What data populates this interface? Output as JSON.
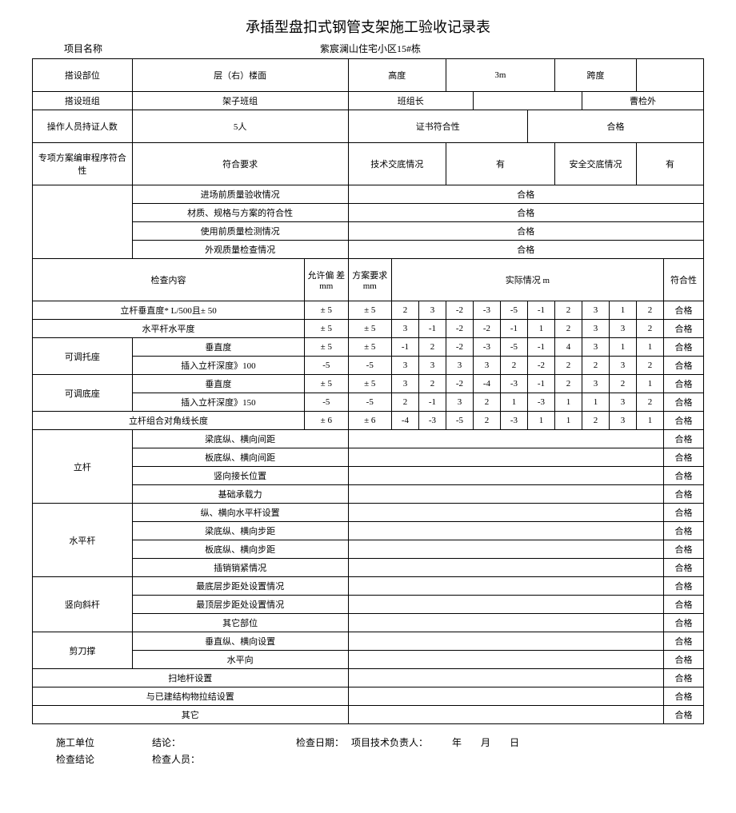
{
  "title": "承插型盘扣式钢管支架施工验收记录表",
  "project_label": "项目名称",
  "project_name": "紫宸澜山住宅小区15#栋",
  "r1": {
    "a": "搭设部位",
    "b": "层（右）楼面",
    "c": "高度",
    "d": "3m",
    "e": "跨度",
    "f": ""
  },
  "r2": {
    "a": "搭设班组",
    "b": "架子班组",
    "c": "班组长",
    "d": "",
    "e": "曹检外"
  },
  "r3": {
    "a": "操作人员持证人数",
    "b": "5人",
    "c": "证书符合性",
    "d": "合格"
  },
  "r4": {
    "a": "专项方案编审程序符合性",
    "b": "符合要求",
    "c": "技术交底情况",
    "d": "有",
    "e": "安全交底情况",
    "f": "有"
  },
  "pre": [
    {
      "label": "进场前质量验收情况",
      "val": "合格"
    },
    {
      "label": "材质、规格与方案的符合性",
      "val": "合格"
    },
    {
      "label": "使用前质量检测情况",
      "val": "合格"
    },
    {
      "label": "外观质量检查情况",
      "val": "合格"
    }
  ],
  "measure_head": {
    "a": "检查内容",
    "b": "允许偏 差 mm",
    "c": "方案要求 mm",
    "d": "实际情况 m",
    "e": "符合性"
  },
  "m": [
    {
      "g": "",
      "label": "立杆垂直度* L/500且± 50",
      "allow": "± 5",
      "plan": "± 5",
      "v": [
        "2",
        "3",
        "-2",
        "-3",
        "-5",
        "-1",
        "2",
        "3",
        "1",
        "2"
      ],
      "ok": "合格"
    },
    {
      "g": "",
      "label": "水平杆水平度",
      "allow": "± 5",
      "plan": "± 5",
      "v": [
        "3",
        "-1",
        "-2",
        "-2",
        "-1",
        "1",
        "2",
        "3",
        "3",
        "2"
      ],
      "ok": "合格"
    },
    {
      "g": "可调托座",
      "label": "垂直度",
      "allow": "± 5",
      "plan": "± 5",
      "v": [
        "-1",
        "2",
        "-2",
        "-3",
        "-5",
        "-1",
        "4",
        "3",
        "1",
        "1"
      ],
      "ok": "合格"
    },
    {
      "g": "",
      "label": "插入立杆深度》100",
      "allow": "-5",
      "plan": "-5",
      "v": [
        "3",
        "3",
        "3",
        "3",
        "2",
        "-2",
        "2",
        "2",
        "3",
        "2"
      ],
      "ok": "合格"
    },
    {
      "g": "可调底座",
      "label": "垂直度",
      "allow": "± 5",
      "plan": "± 5",
      "v": [
        "3",
        "2",
        "-2",
        "-4",
        "-3",
        "-1",
        "2",
        "3",
        "2",
        "1"
      ],
      "ok": "合格"
    },
    {
      "g": "",
      "label": "插入立杆深度》150",
      "allow": "-5",
      "plan": "-5",
      "v": [
        "2",
        "-1",
        "3",
        "2",
        "1",
        "-3",
        "1",
        "1",
        "3",
        "2"
      ],
      "ok": "合格"
    },
    {
      "g": "",
      "label": "立杆组合对角线长度",
      "allow": "± 6",
      "plan": "± 6",
      "v": [
        "-4",
        "-3",
        "-5",
        "2",
        "-3",
        "1",
        "1",
        "2",
        "3",
        "1"
      ],
      "ok": "合格"
    }
  ],
  "groups": [
    {
      "name": "立杆",
      "items": [
        "梁底纵、横向间距",
        "板底纵、横向间距",
        "竖向接长位置",
        "基础承载力"
      ]
    },
    {
      "name": "水平杆",
      "items": [
        "纵、横向水平杆设置",
        "梁底纵、横向步距",
        "板底纵、横向步距",
        "插销销紧情况"
      ]
    },
    {
      "name": "竖向斜杆",
      "items": [
        "最底层步距处设置情况",
        "最顶层步距处设置情况",
        "其它部位"
      ]
    },
    {
      "name": "剪刀撑",
      "items": [
        "垂直纵、横向设置",
        "水平向"
      ]
    }
  ],
  "tail": [
    {
      "label": "扫地杆设置",
      "ok": "合格"
    },
    {
      "label": "与已建结构物拉结设置",
      "ok": "合格"
    },
    {
      "label": "其它",
      "ok": "合格"
    }
  ],
  "ok": "合格",
  "footer": {
    "a": "施工单位",
    "b": "检查结论",
    "c": "结论：",
    "d": "检查人员：",
    "e": "检查日期：",
    "f": "项目技术负责人：",
    "g": "年",
    "h": "月",
    "i": "日"
  }
}
